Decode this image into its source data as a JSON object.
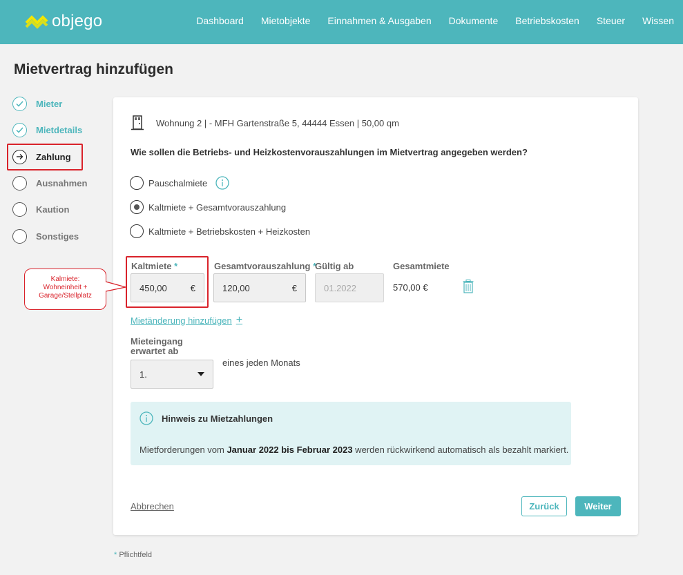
{
  "brand": {
    "name": "objego",
    "accent": "#4db6bc",
    "highlight": "#d9222a"
  },
  "nav": [
    "Dashboard",
    "Mietobjekte",
    "Einnahmen & Ausgaben",
    "Dokumente",
    "Betriebskosten",
    "Steuer",
    "Wissen"
  ],
  "page": {
    "title": "Mietvertrag hinzufügen"
  },
  "steps": [
    {
      "label": "Mieter",
      "state": "done"
    },
    {
      "label": "Mietdetails",
      "state": "done"
    },
    {
      "label": "Zahlung",
      "state": "active"
    },
    {
      "label": "Ausnahmen",
      "state": "todo"
    },
    {
      "label": "Kaution",
      "state": "todo"
    },
    {
      "label": "Sonstiges",
      "state": "todo"
    }
  ],
  "unit": {
    "text": "Wohnung 2 | - MFH Gartenstraße 5, 44444 Essen | 50,00 qm"
  },
  "question": "Wie sollen die Betriebs- und Heizkostenvorauszahlungen im Mietvertrag angegeben werden?",
  "options": [
    {
      "label": "Pauschalmiete",
      "checked": false
    },
    {
      "label": "Kaltmiete + Gesamtvorauszahlung",
      "checked": true
    },
    {
      "label": "Kaltmiete + Betriebskosten + Heizkosten",
      "checked": false
    }
  ],
  "fields": {
    "cold_rent": {
      "label": "Kaltmiete",
      "value": "450,00",
      "currency": "€"
    },
    "prepayment": {
      "label": "Gesamtvorauszahlung",
      "value": "120,00",
      "currency": "€"
    },
    "valid_from": {
      "label": "Gültig ab",
      "placeholder": "01.2022"
    },
    "total": {
      "label": "Gesamtmiete",
      "value": "570,00 €"
    },
    "required_mark": "*"
  },
  "add_change": {
    "label": "Mietänderung hinzufügen",
    "icon": "+"
  },
  "due": {
    "label": "Mieteingang erwartet ab",
    "value": "1.",
    "suffix": "eines jeden Monats"
  },
  "notice": {
    "title": "Hinweis zu Mietzahlungen",
    "text_before": "Mietforderungen vom ",
    "text_bold": "Januar 2022 bis Februar 2023",
    "text_after": " werden rückwirkend automatisch als bezahlt markiert."
  },
  "buttons": {
    "cancel": "Abbrechen",
    "back": "Zurück",
    "next": "Weiter"
  },
  "required_note": "Pflichtfeld",
  "callout": {
    "lines": [
      "Kalmiete:",
      "Wohneinheit +",
      "Garage/Stellplatz"
    ]
  }
}
